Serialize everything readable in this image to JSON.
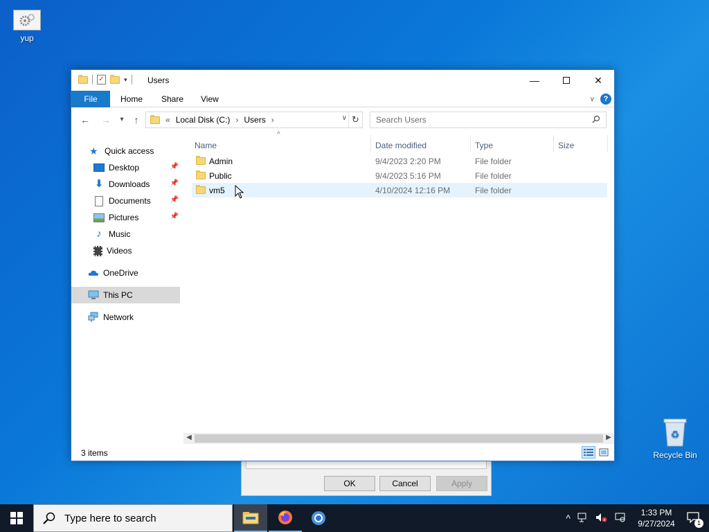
{
  "desktop": {
    "icons": [
      {
        "label": "yup"
      },
      {
        "label": "Recycle Bin"
      }
    ]
  },
  "back_dialog": {
    "ok_label": "OK",
    "cancel_label": "Cancel",
    "apply_label": "Apply"
  },
  "window": {
    "title": "Users",
    "ribbon_tabs": [
      "File",
      "Home",
      "Share",
      "View"
    ],
    "address": {
      "prefix": "«",
      "crumbs": [
        "Local Disk (C:)",
        "Users"
      ]
    },
    "search_placeholder": "Search Users",
    "nav": {
      "quick_access": "Quick access",
      "items": [
        "Desktop",
        "Downloads",
        "Documents",
        "Pictures",
        "Music",
        "Videos"
      ],
      "onedrive": "OneDrive",
      "this_pc": "This PC",
      "network": "Network"
    },
    "columns": [
      "Name",
      "Date modified",
      "Type",
      "Size"
    ],
    "rows": [
      {
        "name": "Admin",
        "date": "9/4/2023 2:20 PM",
        "type": "File folder"
      },
      {
        "name": "Public",
        "date": "9/4/2023 5:16 PM",
        "type": "File folder"
      },
      {
        "name": "vm5",
        "date": "4/10/2024 12:16 PM",
        "type": "File folder"
      }
    ],
    "status": "3 items"
  },
  "taskbar": {
    "search_placeholder": "Type here to search",
    "time": "1:33 PM",
    "date": "9/27/2024",
    "notification_count": "1"
  }
}
